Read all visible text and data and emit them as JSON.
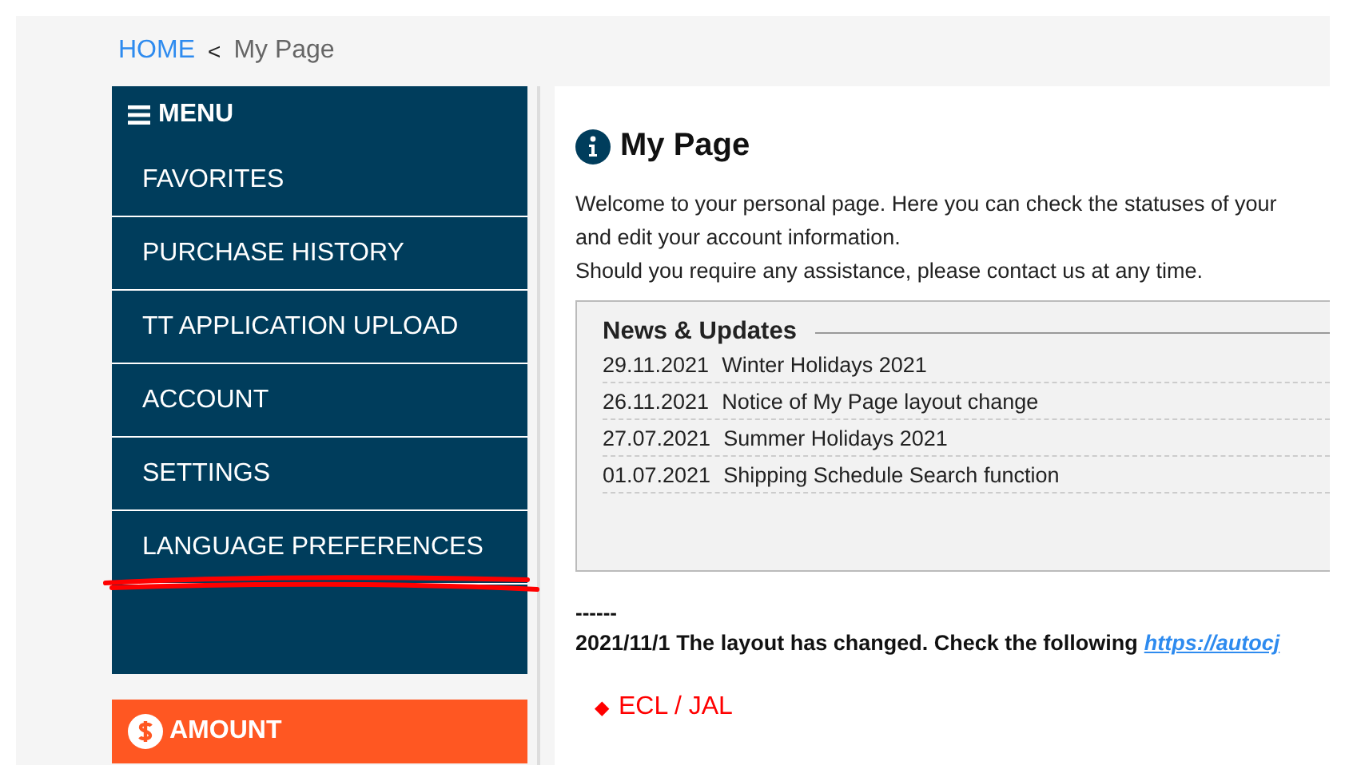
{
  "breadcrumb": {
    "home": "HOME",
    "separator": "<",
    "current": "My Page"
  },
  "menu": {
    "title": "MENU",
    "items": [
      {
        "label": "FAVORITES",
        "underlined": false
      },
      {
        "label": "PURCHASE HISTORY",
        "underlined": false
      },
      {
        "label": "TT APPLICATION UPLOAD",
        "underlined": false
      },
      {
        "label": "ACCOUNT",
        "underlined": false
      },
      {
        "label": "SETTINGS",
        "underlined": false
      },
      {
        "label": "LANGUAGE PREFERENCES",
        "underlined": true
      }
    ]
  },
  "amount": {
    "title": "AMOUNT"
  },
  "page": {
    "title": "My Page",
    "intro": [
      "Welcome to your personal page. Here you can check the statuses of your",
      "and edit your account information.",
      "Should you require any assistance, please contact us at any time."
    ]
  },
  "news": {
    "title": "News & Updates",
    "items": [
      {
        "date": "29.11.2021",
        "text": "Winter Holidays 2021"
      },
      {
        "date": "26.11.2021",
        "text": "Notice of My Page layout change"
      },
      {
        "date": "27.07.2021",
        "text": "Summer Holidays 2021"
      },
      {
        "date": "01.07.2021",
        "text": "Shipping Schedule Search function"
      }
    ]
  },
  "notice": {
    "divider": "------",
    "text": "2021/11/1  The layout has changed. Check the following",
    "link": "https://autocj"
  },
  "section": {
    "marker": "◆",
    "title": "ECL / JAL"
  }
}
